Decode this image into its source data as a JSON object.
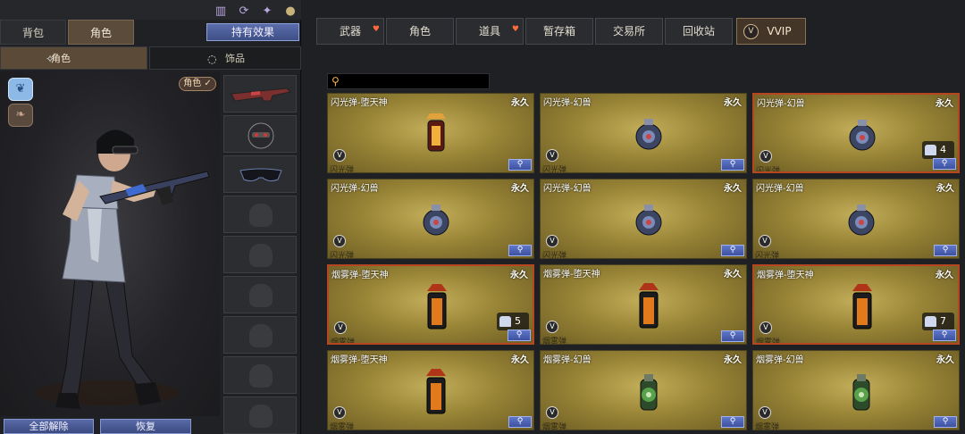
{
  "left_panel": {
    "tabs": [
      {
        "label": "背包"
      },
      {
        "label": "角色"
      }
    ],
    "owned_effects_label": "持有效果",
    "header_icons": [
      "gift-icon",
      "refresh-icon",
      "share-icon",
      "pouch-icon"
    ],
    "subtabs": [
      {
        "label": "角色",
        "icon": "character-icon"
      },
      {
        "label": "饰品",
        "icon": "accessory-icon"
      }
    ],
    "role_badge": "角色 ✓",
    "emblems": [
      "wing-emblem-icon",
      "eagle-emblem-icon"
    ],
    "slots": [
      "rifle-icon",
      "helmet-icon",
      "glasses-icon",
      "empty-slot-icon",
      "empty-slot-icon",
      "empty-slot-icon",
      "empty-slot-icon",
      "empty-slot-icon",
      "empty-slot-icon"
    ],
    "buttons": {
      "unequip_all": "全部解除",
      "restore": "恢复"
    }
  },
  "right_panel": {
    "tabs": [
      {
        "label": "武器",
        "gift": true
      },
      {
        "label": "角色",
        "gift": false
      },
      {
        "label": "道具",
        "gift": true
      },
      {
        "label": "暂存箱",
        "gift": false
      },
      {
        "label": "交易所",
        "gift": false
      },
      {
        "label": "回收站",
        "gift": false
      },
      {
        "label": "VVIP",
        "gift": false
      }
    ],
    "search": {
      "placeholder": ""
    },
    "items": [
      {
        "name": "闪光弹-堕天神",
        "duration": "永久",
        "category": "闪光弹",
        "qty": "",
        "kind": "flash-demon",
        "selected": false
      },
      {
        "name": "闪光弹-幻兽",
        "duration": "永久",
        "category": "闪光弹",
        "qty": "",
        "kind": "flash-beast",
        "selected": false
      },
      {
        "name": "闪光弹-幻兽",
        "duration": "永久",
        "category": "闪光弹",
        "qty": "4",
        "kind": "flash-beast",
        "selected": true
      },
      {
        "name": "闪光弹-幻兽",
        "duration": "永久",
        "category": "闪光弹",
        "qty": "",
        "kind": "flash-beast",
        "selected": false
      },
      {
        "name": "闪光弹-幻兽",
        "duration": "永久",
        "category": "闪光弹",
        "qty": "",
        "kind": "flash-beast",
        "selected": false
      },
      {
        "name": "闪光弹-幻兽",
        "duration": "永久",
        "category": "闪光弹",
        "qty": "",
        "kind": "flash-beast",
        "selected": false
      },
      {
        "name": "烟雾弹-堕天神",
        "duration": "永久",
        "category": "烟雾弹",
        "qty": "5",
        "kind": "smoke-demon",
        "selected": true
      },
      {
        "name": "烟雾弹-堕天神",
        "duration": "永久",
        "category": "烟雾弹",
        "qty": "",
        "kind": "smoke-demon",
        "selected": false
      },
      {
        "name": "烟雾弹-堕天神",
        "duration": "永久",
        "category": "烟雾弹",
        "qty": "7",
        "kind": "smoke-demon",
        "selected": true
      },
      {
        "name": "烟雾弹-堕天神",
        "duration": "永久",
        "category": "烟雾弹",
        "qty": "",
        "kind": "smoke-demon",
        "selected": false
      },
      {
        "name": "烟雾弹-幻兽",
        "duration": "永久",
        "category": "烟雾弹",
        "qty": "",
        "kind": "smoke-beast",
        "selected": false
      },
      {
        "name": "烟雾弹-幻兽",
        "duration": "永久",
        "category": "烟雾弹",
        "qty": "",
        "kind": "smoke-beast",
        "selected": false
      }
    ],
    "zoom_icon": "magnifier-icon",
    "vip_mark": "V"
  },
  "colors": {
    "card_gold": "#9a8637",
    "selected_border": "#b6461f",
    "button_blue": "#4a5c9a"
  }
}
